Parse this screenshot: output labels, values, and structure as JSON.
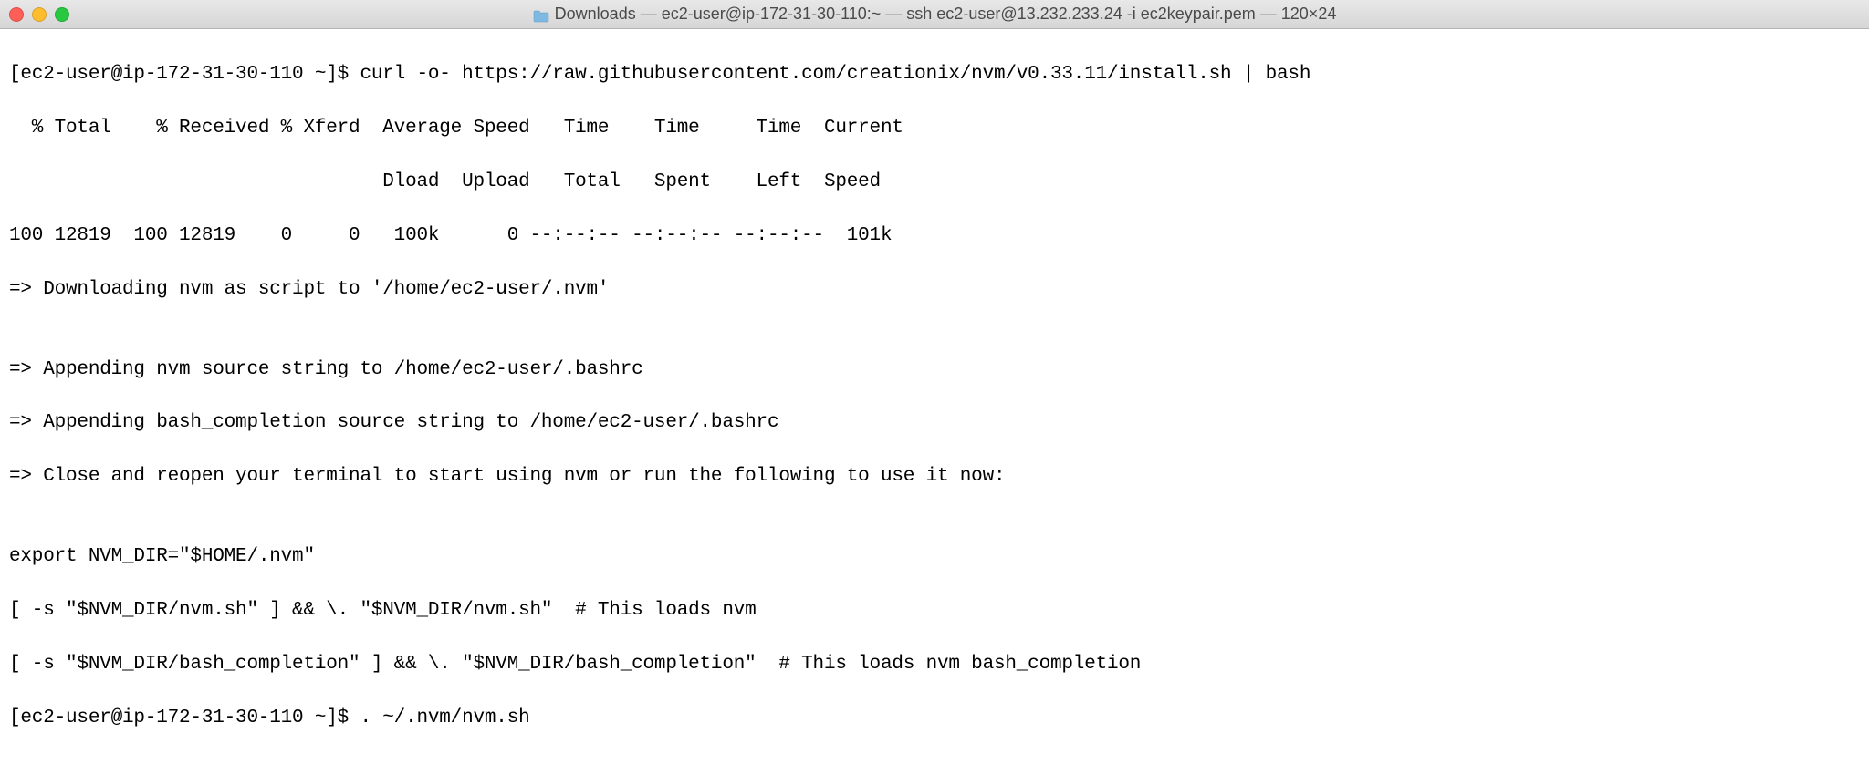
{
  "titlebar": {
    "folder_icon": "folder-icon",
    "title": "Downloads — ec2-user@ip-172-31-30-110:~ — ssh ec2-user@13.232.233.24 -i ec2keypair.pem — 120×24"
  },
  "terminal": {
    "lines": [
      "[ec2-user@ip-172-31-30-110 ~]$ curl -o- https://raw.githubusercontent.com/creationix/nvm/v0.33.11/install.sh | bash",
      "  % Total    % Received % Xferd  Average Speed   Time    Time     Time  Current",
      "                                 Dload  Upload   Total   Spent    Left  Speed",
      "100 12819  100 12819    0     0   100k      0 --:--:-- --:--:-- --:--:--  101k",
      "=> Downloading nvm as script to '/home/ec2-user/.nvm'",
      "",
      "=> Appending nvm source string to /home/ec2-user/.bashrc",
      "=> Appending bash_completion source string to /home/ec2-user/.bashrc",
      "=> Close and reopen your terminal to start using nvm or run the following to use it now:",
      "",
      "export NVM_DIR=\"$HOME/.nvm\"",
      "[ -s \"$NVM_DIR/nvm.sh\" ] && \\. \"$NVM_DIR/nvm.sh\"  # This loads nvm",
      "[ -s \"$NVM_DIR/bash_completion\" ] && \\. \"$NVM_DIR/bash_completion\"  # This loads nvm bash_completion",
      "[ec2-user@ip-172-31-30-110 ~]$ . ~/.nvm/nvm.sh"
    ]
  }
}
